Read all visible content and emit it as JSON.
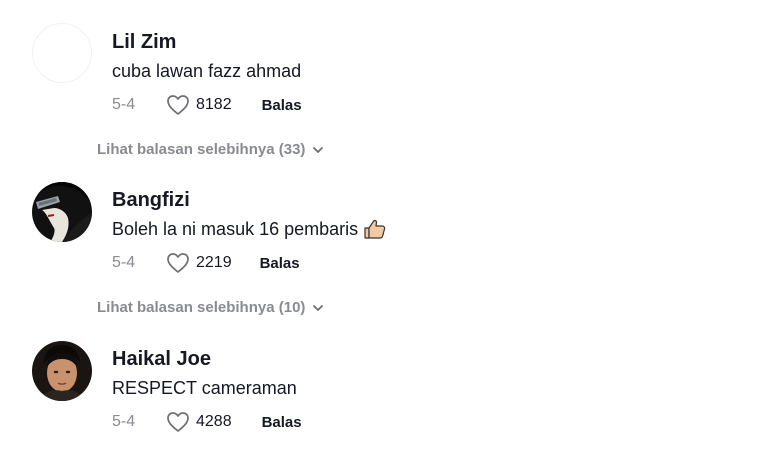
{
  "comments": [
    {
      "username": "Lil Zim",
      "text": "cuba lawan fazz ahmad",
      "date": "5-4",
      "likes": "8182",
      "reply_label": "Balas",
      "avatar_icon": "blank-avatar"
    },
    {
      "username": "Bangfizi",
      "text": "Boleh la ni masuk 16 pembaris",
      "emoji_icon": "thumbs-up-emoji",
      "date": "5-4",
      "likes": "2219",
      "reply_label": "Balas",
      "avatar_icon": "dark-anime-avatar"
    },
    {
      "username": "Haikal Joe",
      "text": "RESPECT cameraman",
      "date": "5-4",
      "likes": "4288",
      "reply_label": "Balas",
      "avatar_icon": "portrait-avatar"
    }
  ],
  "more_replies": [
    {
      "label": "Lihat balasan selebihnya (33)"
    },
    {
      "label": "Lihat balasan selebihnya (10)"
    }
  ],
  "colors": {
    "text": "#161823",
    "muted": "#8a8b91"
  }
}
